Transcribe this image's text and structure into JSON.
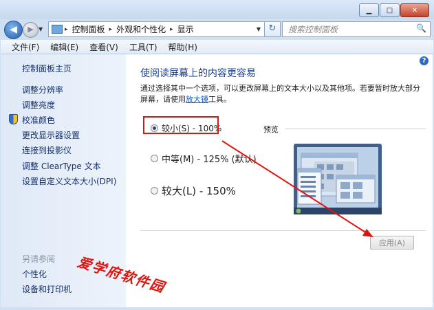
{
  "window": {
    "controls": {
      "minimize": "▁",
      "maximize": "□",
      "close": "✕"
    }
  },
  "nav": {
    "back_glyph": "◀",
    "forward_glyph": "▶",
    "breadcrumb": [
      "控制面板",
      "外观和个性化",
      "显示"
    ],
    "breadcrumb_sep": "▸",
    "refresh_glyph": "↻",
    "search_placeholder": "搜索控制面板",
    "search_icon": "🔍"
  },
  "menu": [
    "文件(F)",
    "编辑(E)",
    "查看(V)",
    "工具(T)",
    "帮助(H)"
  ],
  "sidebar": {
    "items": [
      "控制面板主页",
      "调整分辨率",
      "调整亮度",
      "校准颜色",
      "更改显示器设置",
      "连接到投影仪",
      "调整 ClearType 文本",
      "设置自定义文本大小(DPI)"
    ],
    "see_also_header": "另请参阅",
    "see_also": [
      "个性化",
      "设备和打印机"
    ]
  },
  "main": {
    "help_glyph": "?",
    "title": "使阅读屏幕上的内容更容易",
    "desc_before": "通过选择其中一个选项，可以更改屏幕上的文本大小以及其他项。若要暂时放大部分屏幕，请使用",
    "desc_link": "放大镜",
    "desc_after": "工具。",
    "options": [
      {
        "label": "较小(S) - 100%",
        "selected": true
      },
      {
        "label": "中等(M) - 125% (默认)",
        "selected": false
      },
      {
        "label": "较大(L) - 150%",
        "selected": false
      }
    ],
    "preview_label": "预览",
    "apply_label": "应用(A)"
  },
  "watermark": "爱学府软件园",
  "colors": {
    "annotation": "#e0140f",
    "link": "#0b5bd3",
    "title": "#1a3e8c"
  }
}
